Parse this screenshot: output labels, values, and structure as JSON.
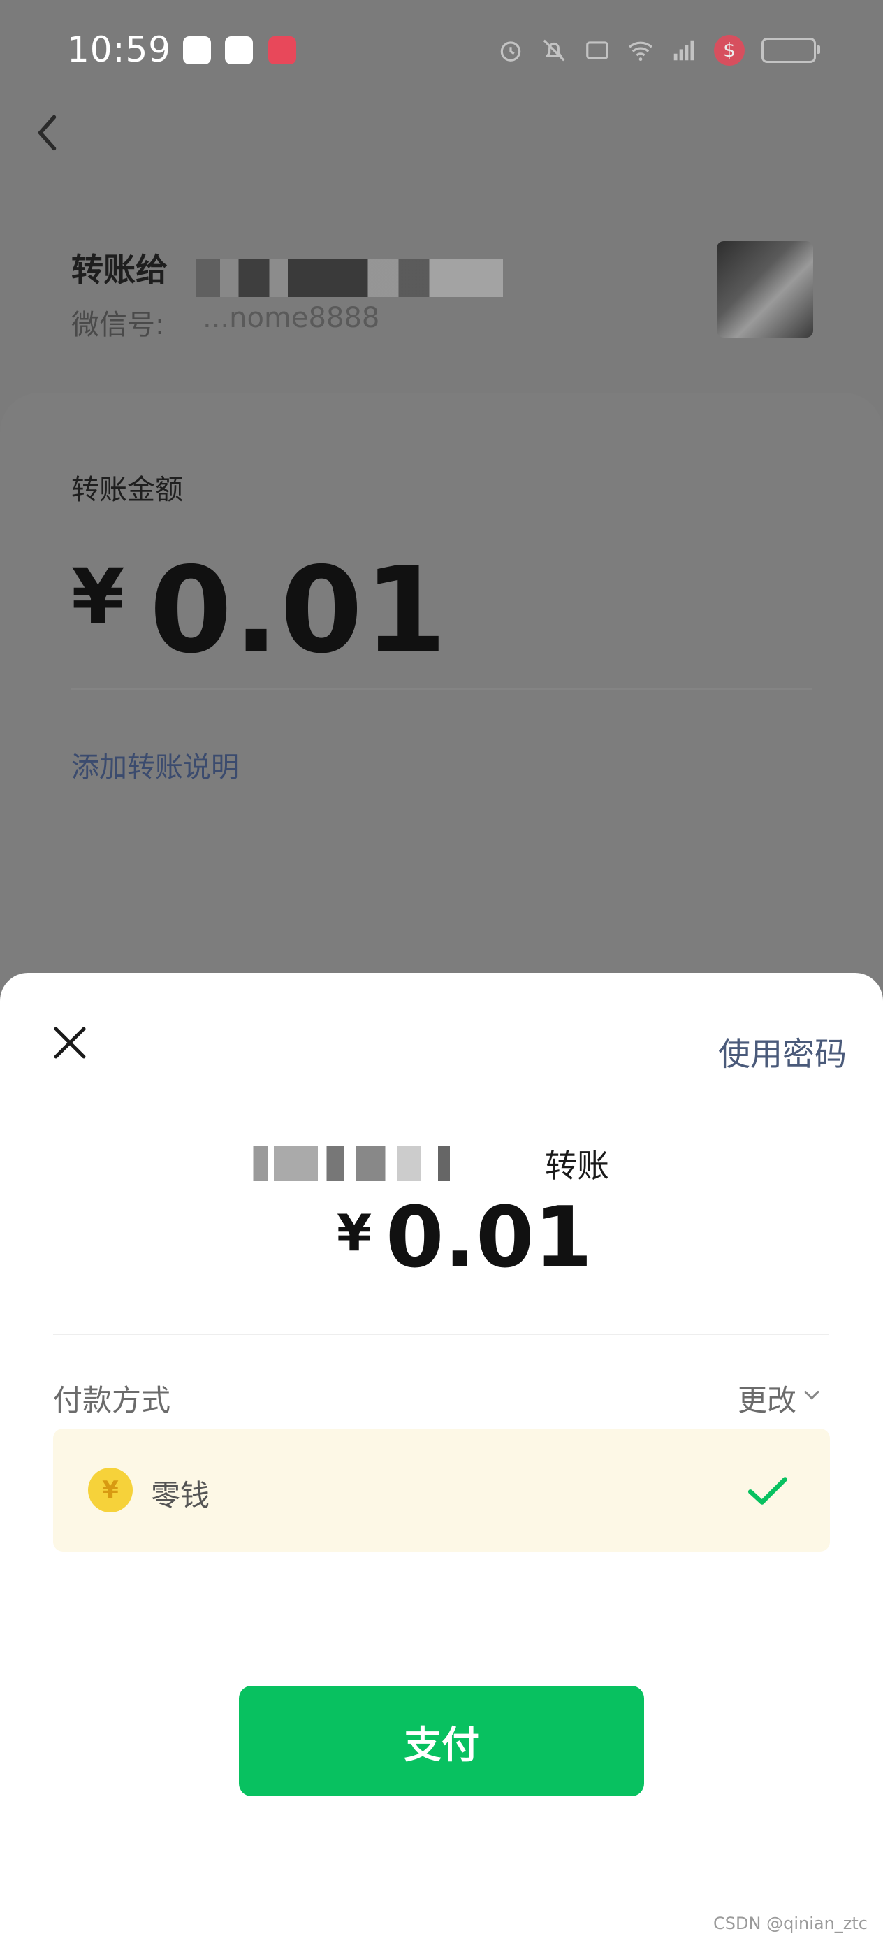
{
  "status_bar": {
    "time": "10:59",
    "app_icons": [
      "calendar-icon",
      "notes-icon",
      "red-app-icon"
    ],
    "right_icons": [
      "alarm-icon",
      "mute-icon",
      "message-icon",
      "wifi-icon",
      "signal-icon",
      "security-shield-icon",
      "battery-icon"
    ],
    "shield_glyph": "$"
  },
  "header": {
    "transfer_to_label": "转账给",
    "wechat_id_label": "微信号:",
    "wechat_id_value": "...nome8888"
  },
  "amount_card": {
    "label": "转账金额",
    "currency_symbol": "¥",
    "amount": "0.01",
    "add_note_link": "添加转账说明"
  },
  "payment_sheet": {
    "use_password_label": "使用密码",
    "title_suffix": "转账",
    "currency_symbol": "¥",
    "amount": "0.01",
    "payment_method_label": "付款方式",
    "change_label": "更改",
    "selected_method": "零钱",
    "coin_glyph": "¥",
    "pay_button_label": "支付"
  },
  "watermark": "CSDN @qinian_ztc",
  "colors": {
    "overlay": "#7b7b7b",
    "pay_green": "#08c160",
    "link_blue": "#4a5a7a",
    "method_bg": "#fdf8e6"
  }
}
